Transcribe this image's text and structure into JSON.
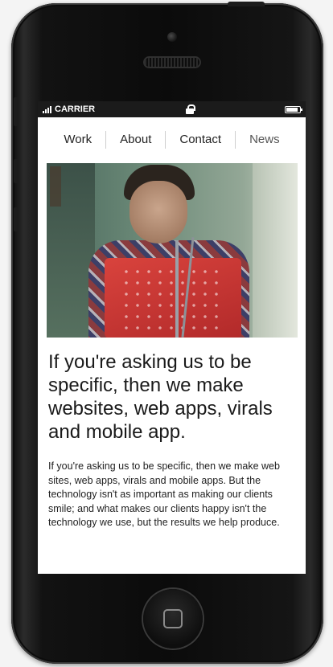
{
  "status_bar": {
    "carrier": "CARRIER",
    "lock_icon": "lock-icon",
    "battery_icon": "battery-icon",
    "signal_icon": "signal-bars-icon"
  },
  "nav": {
    "items": [
      "Work",
      "About",
      "Contact",
      "News"
    ]
  },
  "hero": {
    "image_desc_icon": "photo"
  },
  "headline": "If you're asking us to be specific, then we make websites, web apps, virals and mobile app.",
  "body": "If you're asking us to be specific, then we make web sites, web apps, virals and mobile apps. But the technology isn't as important as making our clients smile; and what makes our clients happy isn't the technology we use, but the results we help produce."
}
